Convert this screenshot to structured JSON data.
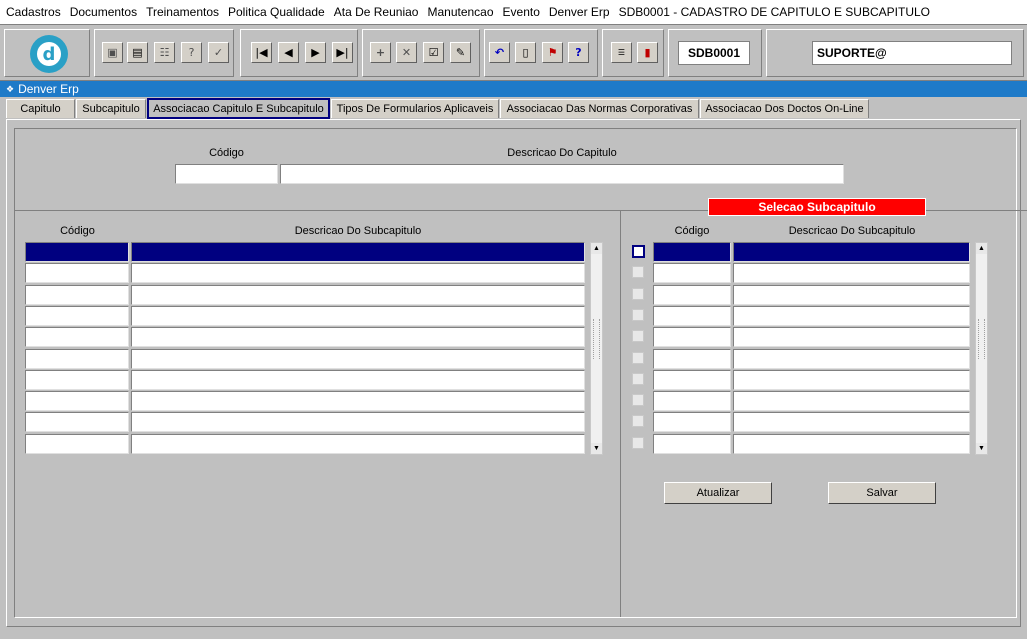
{
  "menu": [
    "Cadastros",
    "Documentos",
    "Treinamentos",
    "Politica Qualidade",
    "Ata De Reuniao",
    "Manutencao",
    "Evento",
    "Denver Erp",
    "SDB0001 - CADASTRO DE CAPITULO E SUBCAPITULO"
  ],
  "toolbar": {
    "form_code": "SDB0001",
    "user": "SUPORTE@",
    "logo_letter": "d",
    "icons": [
      "save-icon",
      "print-preview-icon",
      "print-icon",
      "query-icon",
      "edit-icon",
      "first-record-icon",
      "prev-record-icon",
      "next-record-icon",
      "last-record-icon",
      "insert-icon",
      "delete-icon",
      "check-icon",
      "pencil-icon",
      "undo-icon",
      "clipboard-icon",
      "security-icon",
      "help-icon",
      "menu-icon",
      "exit-icon"
    ]
  },
  "window_title": "Denver Erp",
  "tabs": [
    "Capitulo",
    "Subcapitulo",
    "Associacao Capitulo E Subcapitulo",
    "Tipos De Formularios Aplicaveis",
    "Associacao Das Normas Corporativas",
    "Associacao Dos Doctos On-Line"
  ],
  "active_tab": "Associacao Capitulo E Subcapitulo",
  "capitulo": {
    "codigo_label": "Código",
    "descricao_label": "Descricao Do Capitulo",
    "codigo": "",
    "descricao": ""
  },
  "subcapitulo_left": {
    "codigo_label": "Código",
    "descricao_label": "Descricao Do Subcapitulo",
    "rows": 10
  },
  "selecao": {
    "title": "Selecao Subcapitulo",
    "codigo_label": "Código",
    "descricao_label": "Descricao Do Subcapitulo",
    "rows": 10
  },
  "buttons": {
    "atualizar": "Atualizar",
    "salvar": "Salvar"
  }
}
